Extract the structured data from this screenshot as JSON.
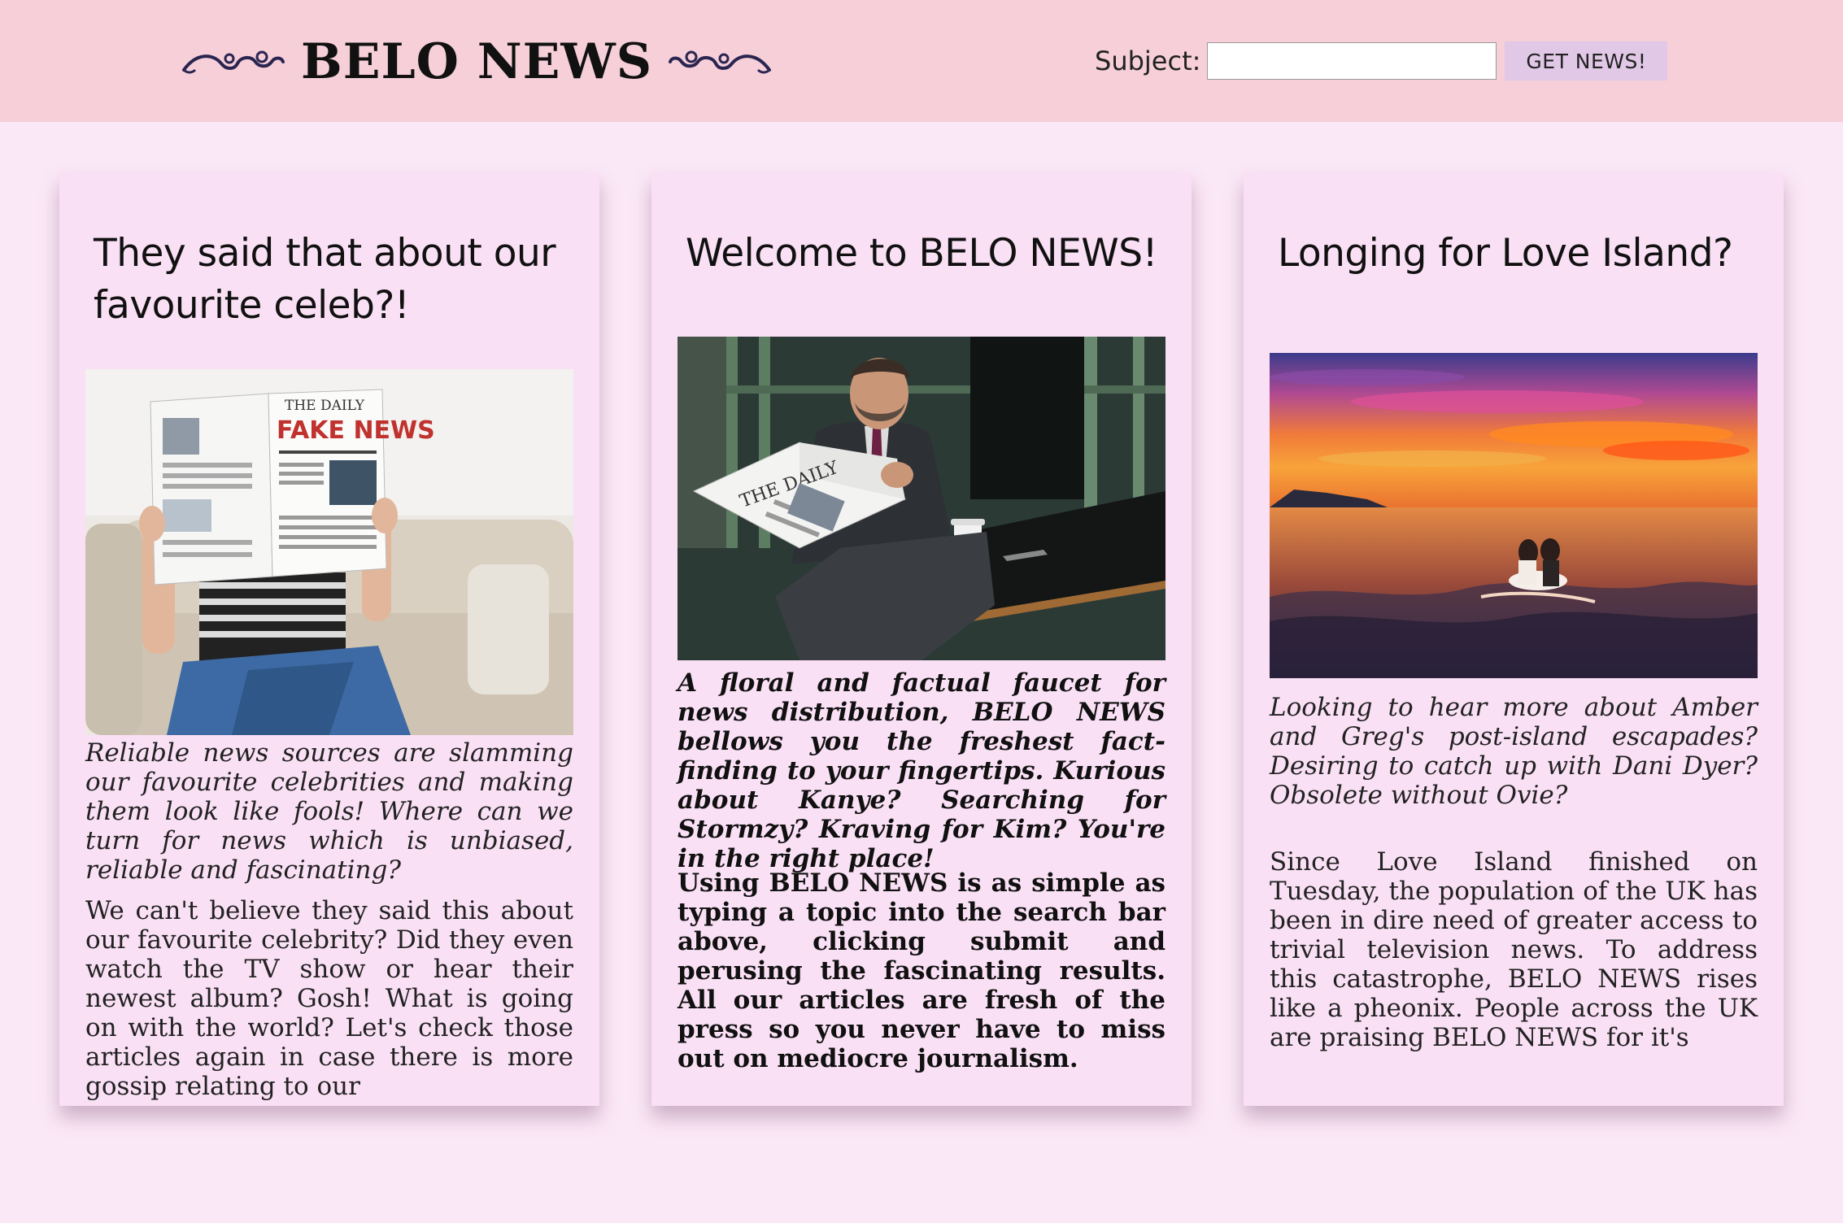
{
  "header": {
    "title": "BELO NEWS",
    "search_label": "Subject:",
    "search_value": "",
    "button_label": "GET NEWS!",
    "background": "#f6cfd9"
  },
  "page": {
    "background": "#fbe8f7",
    "card_background": "#fae0f5"
  },
  "cards": [
    {
      "title": "They said that about our favourite celeb?!",
      "image": "woman-reading-fake-news-newspaper-photo",
      "intro": "Reliable news sources are slamming our favourite celebrities and making them look like fools! Where can we turn for news which is unbiased, reliable and fascinating?",
      "body": "We can't believe they said this about our favourite celebrity? Did they even watch the TV show or hear their newest album? Gosh! What is going on with the world? Let's check those articles again in case there is more gossip relating to our"
    },
    {
      "title": "Welcome to BELO NEWS!",
      "image": "man-reading-newspaper-cafe-photo",
      "intro": "A floral and factual faucet for news distribution, BELO NEWS bellows you the freshest fact-finding to your fingertips. Kurious about Kanye? Searching for Stormzy? Kraving for Kim? You're in the right place!",
      "body": "Using BELO NEWS is as simple as typing a topic into the search bar above, clicking submit and perusing the fascinating results. All our articles are fresh of the press so you never have to miss out on mediocre journalism."
    },
    {
      "title": "Longing for Love Island?",
      "image": "sunset-beach-couple-photo",
      "intro": "Looking to hear more about Amber and Greg's post-island escapades? Desiring to catch up with Dani Dyer? Obsolete without Ovie?",
      "body": "Since Love Island finished on Tuesday, the population of the UK has been in dire need of greater access to trivial television news. To address this catastrophe, BELO NEWS rises like a pheonix. People across the UK are praising BELO NEWS for it's"
    }
  ]
}
